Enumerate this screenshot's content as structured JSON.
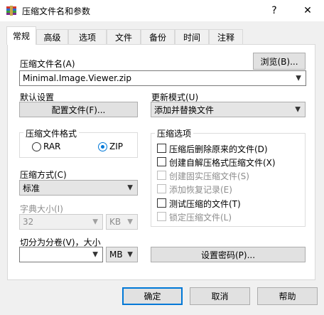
{
  "window": {
    "title": "压缩文件名和参数",
    "help_glyph": "?",
    "close_glyph": "✕"
  },
  "tabs": [
    {
      "label": "常规"
    },
    {
      "label": "高级"
    },
    {
      "label": "选项"
    },
    {
      "label": "文件"
    },
    {
      "label": "备份"
    },
    {
      "label": "时间"
    },
    {
      "label": "注释"
    }
  ],
  "archive": {
    "name_label": "压缩文件名(A)",
    "browse_label": "浏览(B)...",
    "name_value": "Minimal.Image.Viewer.zip"
  },
  "defaults": {
    "label": "默认设置",
    "profile_button": "配置文件(F)..."
  },
  "update_mode": {
    "label": "更新模式(U)",
    "value": "添加并替换文件"
  },
  "format": {
    "legend": "压缩文件格式",
    "rar_label": "RAR",
    "zip_label": "ZIP",
    "selected": "ZIP"
  },
  "method": {
    "label": "压缩方式(C)",
    "value": "标准"
  },
  "dictionary": {
    "label": "字典大小(I)",
    "value": "32",
    "unit": "KB"
  },
  "split": {
    "label": "切分为分卷(V)，大小",
    "value": "",
    "unit": "MB"
  },
  "options": {
    "legend": "压缩选项",
    "items": [
      {
        "label": "压缩后删除原来的文件(D)",
        "checked": false,
        "enabled": true
      },
      {
        "label": "创建自解压格式压缩文件(X)",
        "checked": false,
        "enabled": true
      },
      {
        "label": "创建固实压缩文件(S)",
        "checked": false,
        "enabled": false
      },
      {
        "label": "添加恢复记录(E)",
        "checked": false,
        "enabled": false
      },
      {
        "label": "测试压缩的文件(T)",
        "checked": false,
        "enabled": true
      },
      {
        "label": "锁定压缩文件(L)",
        "checked": false,
        "enabled": false
      }
    ]
  },
  "password_button": "设置密码(P)...",
  "footer": {
    "ok": "确定",
    "cancel": "取消",
    "help": "帮助"
  },
  "colors": {
    "accent": "#0078d7",
    "disabled_text": "#8d8d8d",
    "dialog_bg": "#f0f0f0"
  }
}
